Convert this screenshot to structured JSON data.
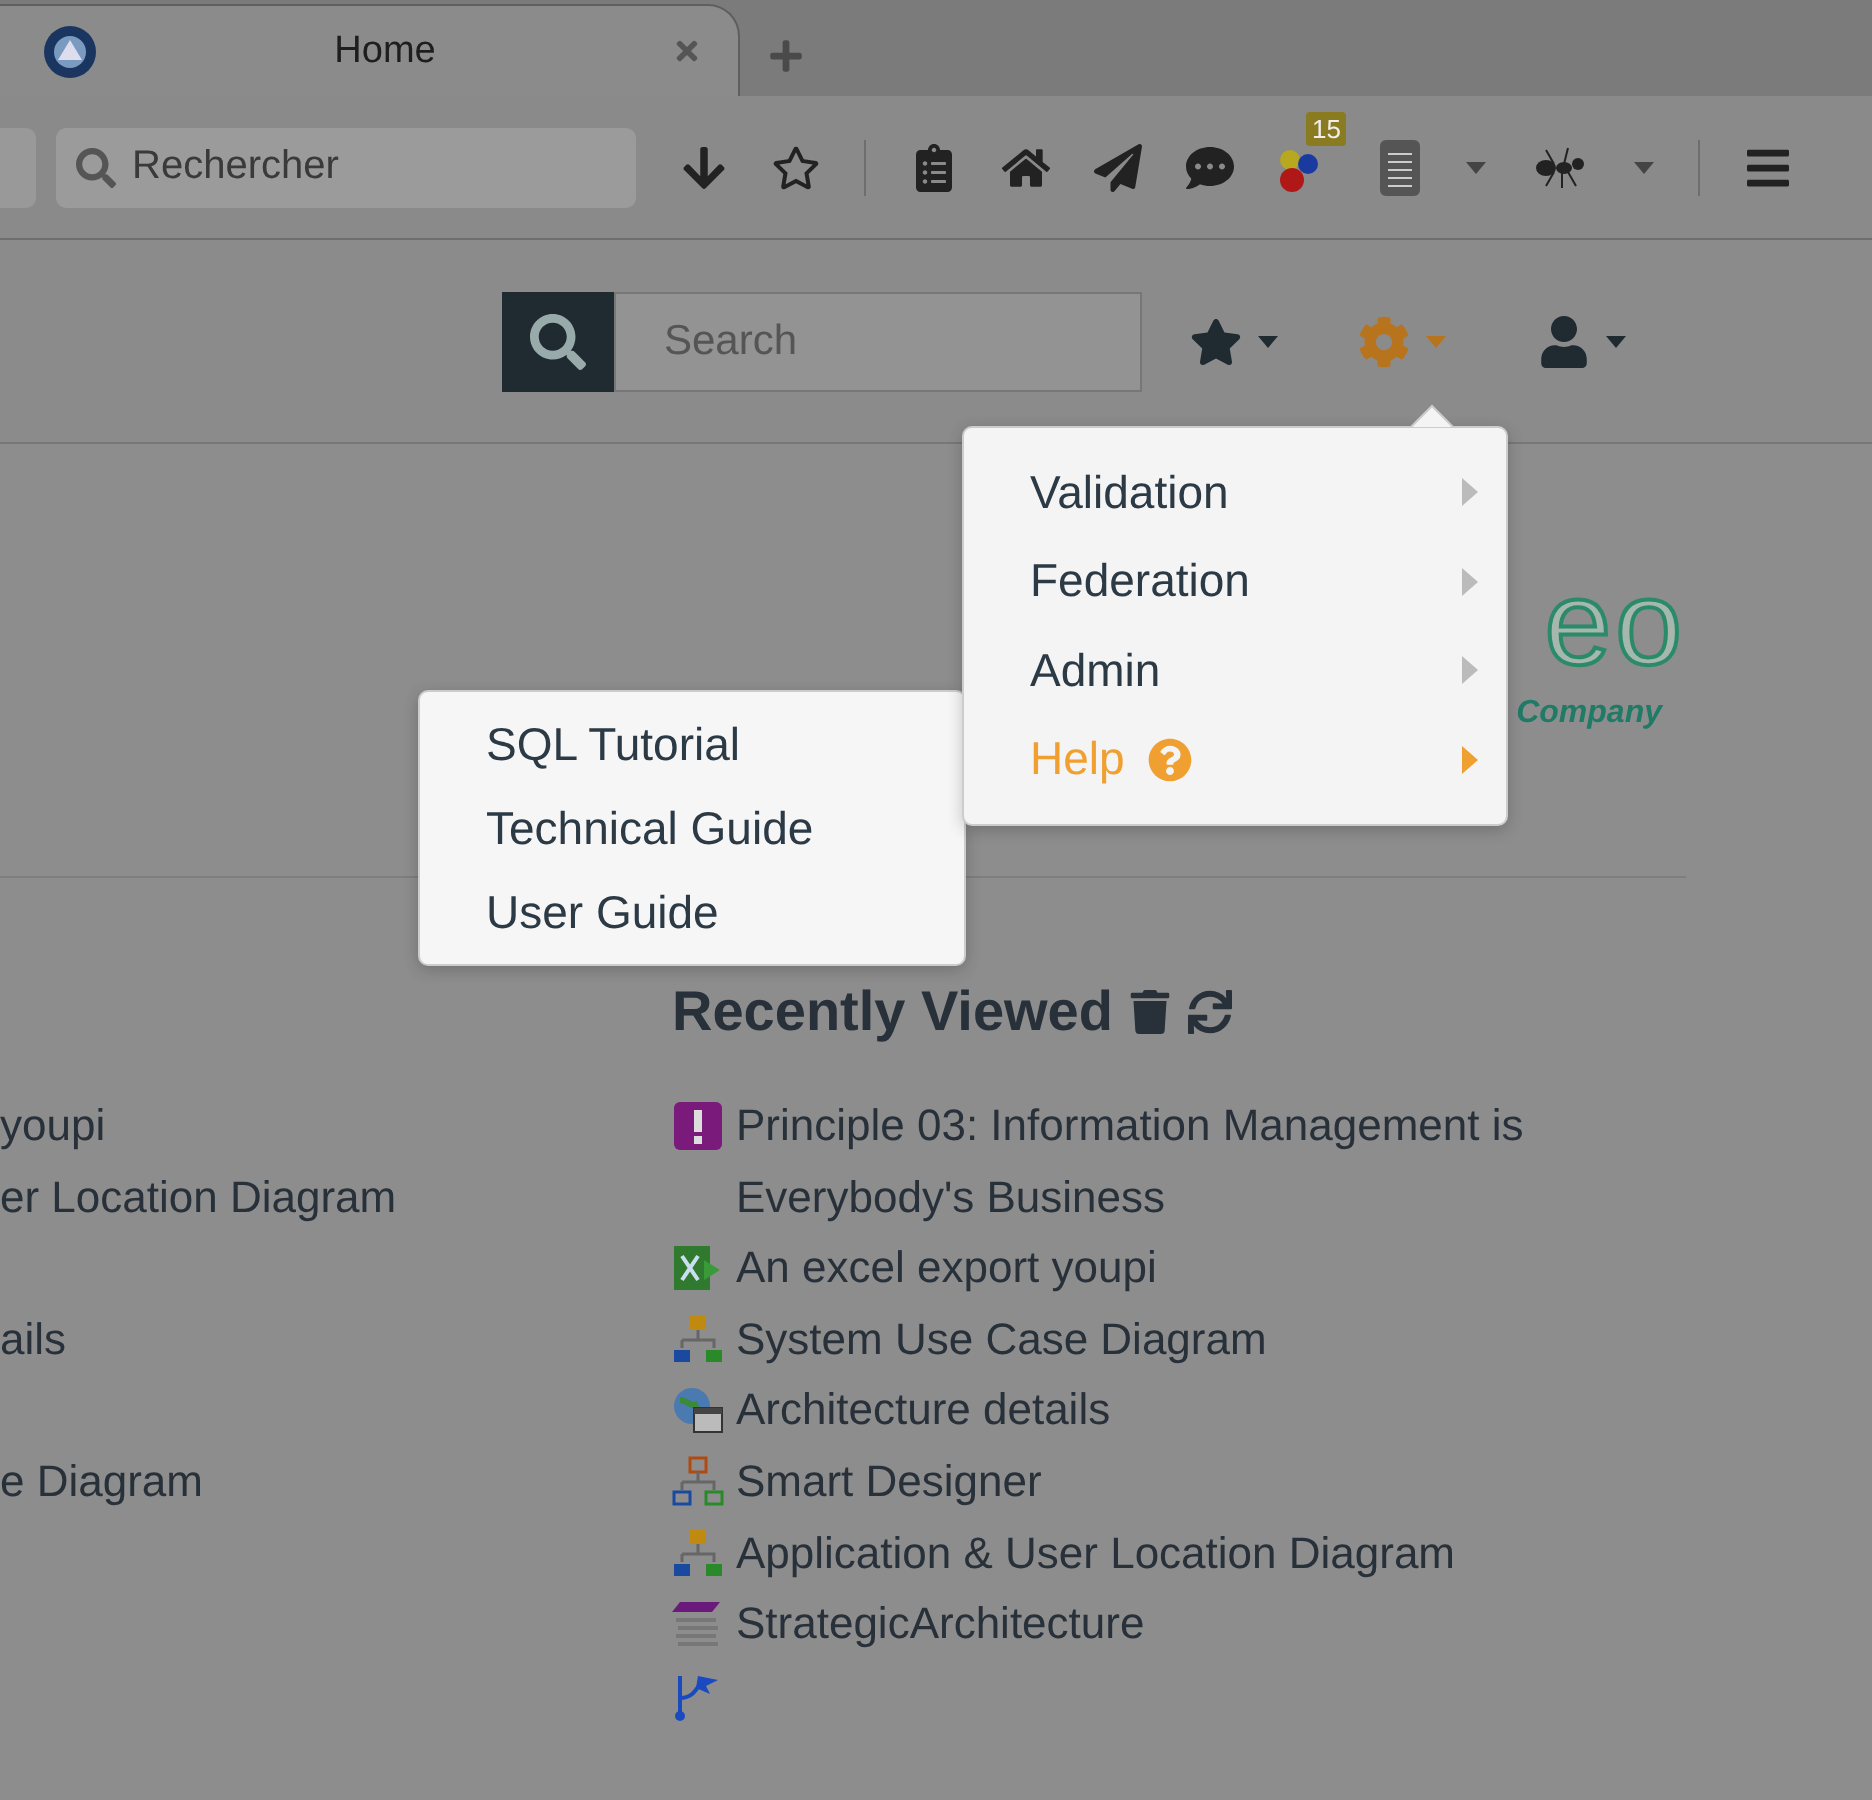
{
  "browser": {
    "tab": {
      "title": "Home",
      "selected": true
    },
    "search": {
      "placeholder": "Rechercher"
    },
    "badge": "15"
  },
  "header": {
    "search": {
      "placeholder": "Search"
    }
  },
  "logo": {
    "text": "eo",
    "tagline": "Company"
  },
  "left_list": [
    "youpi",
    "er Location Diagram",
    "ails",
    "e Diagram"
  ],
  "recent": {
    "title": "Recently Viewed",
    "items": [
      {
        "kind": "principle",
        "label": "Principle 03: Information Management is Everybody's Business"
      },
      {
        "kind": "excel",
        "label": "An excel export youpi"
      },
      {
        "kind": "diagram",
        "label": "System Use Case Diagram"
      },
      {
        "kind": "architecture",
        "label": "Architecture details"
      },
      {
        "kind": "designer",
        "label": "Smart Designer"
      },
      {
        "kind": "diagram",
        "label": "Application & User Location Diagram"
      },
      {
        "kind": "strategy",
        "label": "StrategicArchitecture"
      },
      {
        "kind": "branch"
      }
    ]
  },
  "menu": {
    "items": [
      {
        "label": "Validation",
        "selected": false
      },
      {
        "label": "Federation",
        "selected": false
      },
      {
        "label": "Admin",
        "selected": false
      },
      {
        "label": "Help",
        "selected": true
      }
    ]
  },
  "submenu": {
    "items": [
      "SQL Tutorial",
      "Technical Guide",
      "User Guide"
    ]
  }
}
